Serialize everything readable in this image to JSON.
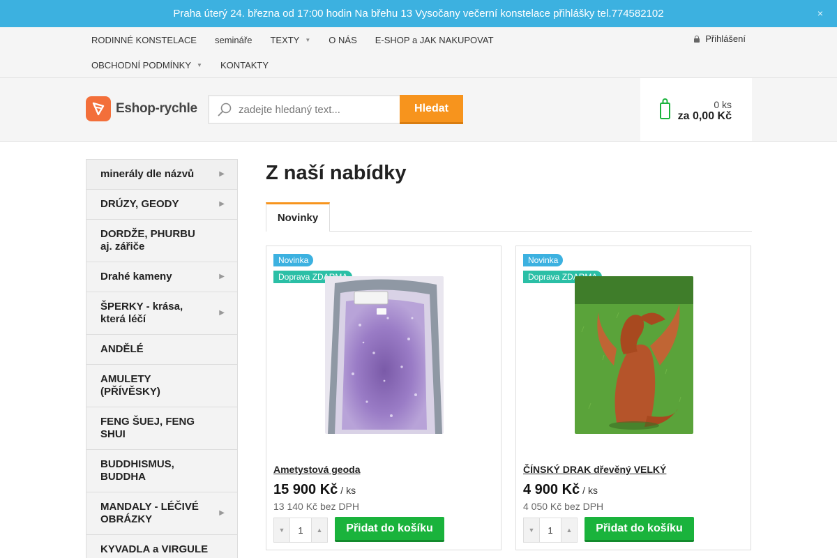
{
  "announcement": {
    "text": "Praha úterý 24. března od 17:00 hodin Na břehu 13 Vysočany večerní konstelace přihlášky tel.774582102",
    "close_glyph": "×"
  },
  "topmenu": {
    "row1": [
      {
        "label": "RODINNÉ KONSTELACE"
      },
      {
        "label": "semináře"
      },
      {
        "label": "TEXTY"
      },
      {
        "label": "O NÁS"
      },
      {
        "label": "E-SHOP a JAK NAKUPOVAT"
      }
    ],
    "row2": [
      {
        "label": "OBCHODNÍ PODMÍNKY"
      },
      {
        "label": "KONTAKTY"
      }
    ],
    "login_label": "Přihlášení"
  },
  "header": {
    "logo_text": "Eshop-rychle",
    "search_placeholder": "zadejte hledaný text...",
    "search_button": "Hledat",
    "cart_count": "0 ks",
    "cart_total": "za 0,00 Kč"
  },
  "sidebar": {
    "categories": [
      {
        "label": "minerály dle názvů",
        "has_submenu": true
      },
      {
        "label": "DRÚZY, GEODY",
        "has_submenu": true
      },
      {
        "label": "DORDŽE, PHURBU aj. zářiče",
        "has_submenu": false
      },
      {
        "label": "Drahé kameny",
        "has_submenu": true
      },
      {
        "label": "ŠPERKY - krása, která léčí",
        "has_submenu": true
      },
      {
        "label": "ANDĚLÉ",
        "has_submenu": false
      },
      {
        "label": "AMULETY (PŘÍVĚSKY)",
        "has_submenu": false
      },
      {
        "label": "FENG ŠUEJ, FENG SHUI",
        "has_submenu": false
      },
      {
        "label": "BUDDHISMUS, BUDDHA",
        "has_submenu": false
      },
      {
        "label": "MANDALY - LÉČIVÉ OBRÁZKY",
        "has_submenu": true
      },
      {
        "label": "KYVADLA a VIRGULE",
        "has_submenu": false
      }
    ]
  },
  "main": {
    "title": "Z naší nabídky",
    "tab_label": "Novinky",
    "products": [
      {
        "flag_new": "Novinka",
        "flag_shipping": "Doprava ZDARMA",
        "name": "Ametystová geoda",
        "price": "15 900 Kč",
        "unit": "/ ks",
        "price_without_vat": "13 140 Kč bez DPH",
        "quantity": "1",
        "add_label": "Přidat do košíku"
      },
      {
        "flag_new": "Novinka",
        "flag_shipping": "Doprava ZDARMA",
        "name": "ČÍNSKÝ DRAK dřevěný VELKÝ",
        "price": "4 900 Kč",
        "unit": "/ ks",
        "price_without_vat": "4 050 Kč bez DPH",
        "quantity": "1",
        "add_label": "Přidat do košíku"
      }
    ]
  },
  "colors": {
    "announcement_bg": "#3cb1e0",
    "accent_orange": "#f7941d",
    "add_button_green": "#1ab33c",
    "cart_icon_green": "#1ab33c",
    "logo_orange": "#f36f3a"
  },
  "icons": {
    "announcement_close": "close-icon",
    "login": "lock-icon",
    "search": "magnifier-icon",
    "cart": "shopping-bag-icon",
    "menu_dropdown": "chevron-down-icon",
    "category_submenu": "chevron-right-icon",
    "quantity_decrease": "minus-icon",
    "quantity_increase": "plus-icon"
  }
}
